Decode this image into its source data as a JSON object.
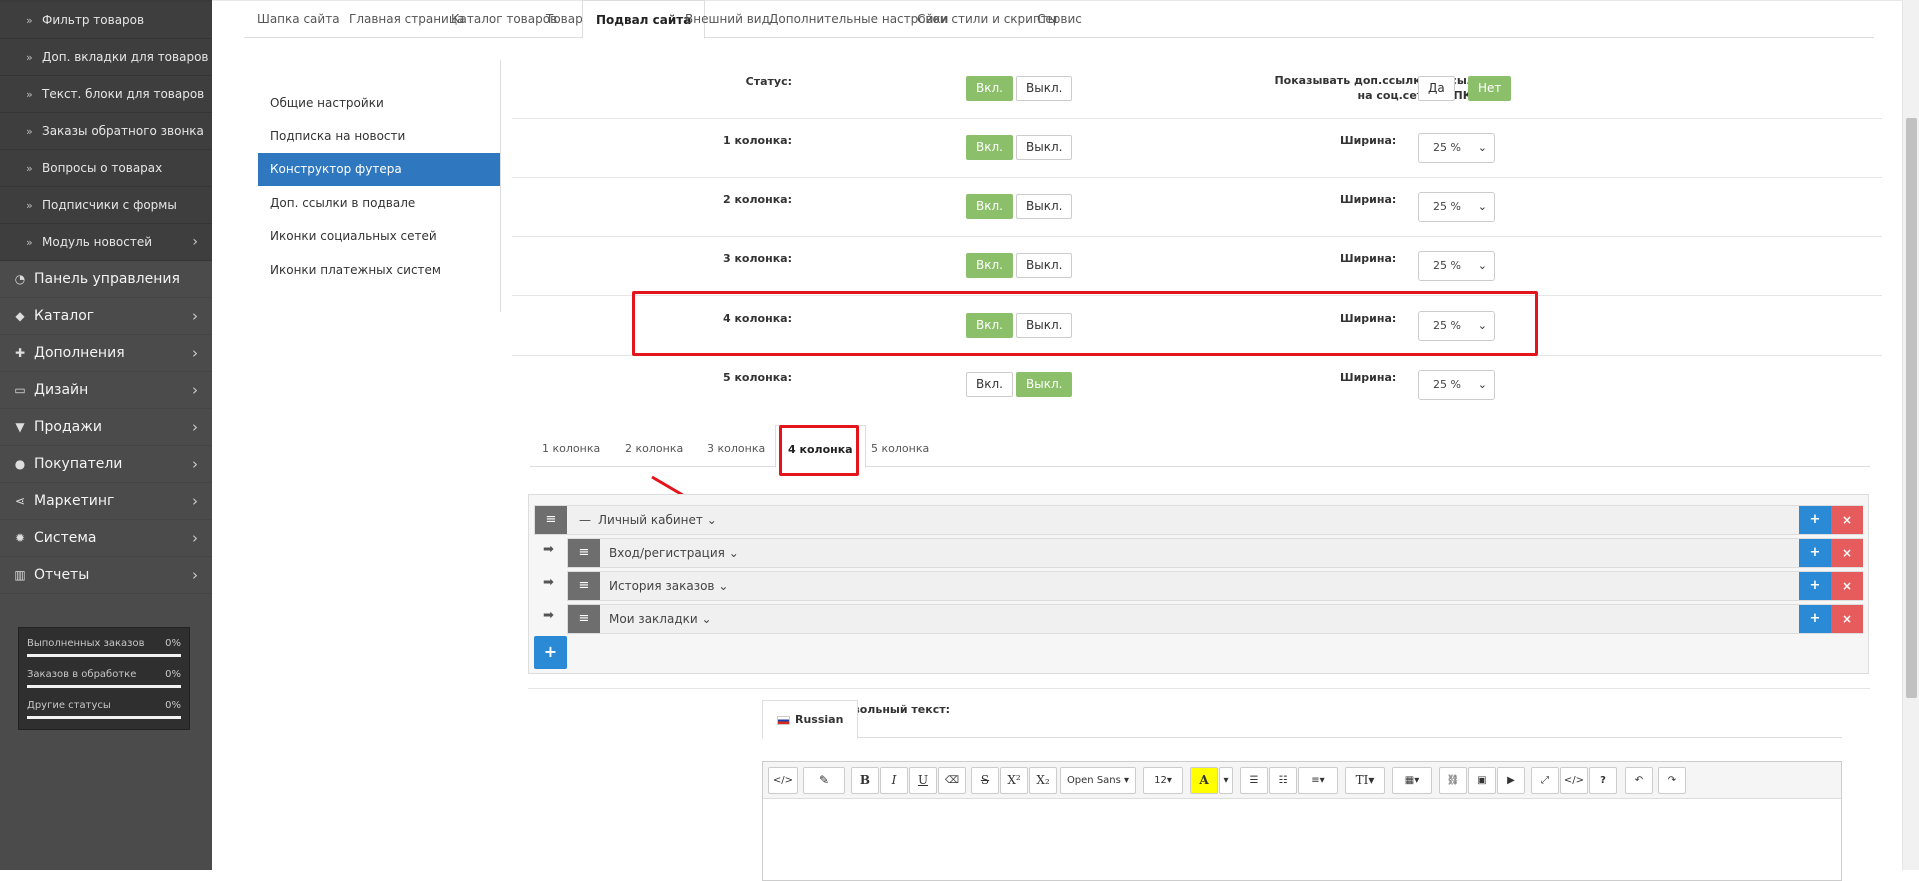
{
  "sidebar": {
    "sub_items": [
      {
        "label": "Фильтр товаров"
      },
      {
        "label": "Доп. вкладки для товаров"
      },
      {
        "label": "Текст. блоки для товаров"
      },
      {
        "label": "Заказы обратного звонка"
      },
      {
        "label": "Вопросы о товарах"
      },
      {
        "label": "Подписчики с формы"
      },
      {
        "label": "Модуль новостей"
      }
    ],
    "main_items": [
      {
        "label": "Панель управления",
        "icon": "dashboard-icon"
      },
      {
        "label": "Каталог",
        "icon": "tag-icon"
      },
      {
        "label": "Дополнения",
        "icon": "puzzle-icon"
      },
      {
        "label": "Дизайн",
        "icon": "monitor-icon"
      },
      {
        "label": "Продажи",
        "icon": "cart-icon"
      },
      {
        "label": "Покупатели",
        "icon": "user-icon"
      },
      {
        "label": "Маркетинг",
        "icon": "share-icon"
      },
      {
        "label": "Система",
        "icon": "gear-icon"
      },
      {
        "label": "Отчеты",
        "icon": "bar-chart-icon"
      }
    ],
    "stats": [
      {
        "label": "Выполненных заказов",
        "value": "0%"
      },
      {
        "label": "Заказов в обработке",
        "value": "0%"
      },
      {
        "label": "Другие статусы",
        "value": "0%"
      }
    ]
  },
  "top_tabs": [
    {
      "label": "Шапка сайта"
    },
    {
      "label": "Главная страница"
    },
    {
      "label": "Каталог товаров"
    },
    {
      "label": "Товар"
    },
    {
      "label": "Подвал сайта",
      "active": true
    },
    {
      "label": "Внешний вид"
    },
    {
      "label": "Дополнительные настройки"
    },
    {
      "label": "Свои стили и скрипты"
    },
    {
      "label": "Сервис"
    }
  ],
  "sub_menu": [
    {
      "label": "Общие настройки"
    },
    {
      "label": "Подписка на новости"
    },
    {
      "label": "Конструктор футера",
      "active": true
    },
    {
      "label": "Доп. ссылки в подвале"
    },
    {
      "label": "Иконки социальных сетей"
    },
    {
      "label": "Иконки платежных систем"
    }
  ],
  "form": {
    "on_label": "Вкл.",
    "off_label": "Выкл.",
    "yes_label": "Да",
    "no_label": "Нет",
    "width_label": "Ширина:",
    "status_label": "Статус:",
    "status_right_label_line1": "Показывать доп.ссылки и ссылки",
    "status_right_label_line2": "на соц.сети на ПК:",
    "help_glyph": "?",
    "rows": [
      {
        "label": "1 колонка:",
        "state": "on",
        "width": "25 %"
      },
      {
        "label": "2 колонка:",
        "state": "on",
        "width": "25 %"
      },
      {
        "label": "3 колонка:",
        "state": "on",
        "width": "25 %"
      },
      {
        "label": "4 колонка:",
        "state": "on",
        "width": "25 %"
      },
      {
        "label": "5 колонка:",
        "state": "off",
        "width": "25 %"
      }
    ]
  },
  "column_tabs": [
    {
      "label": "1 колонка"
    },
    {
      "label": "2 колонка"
    },
    {
      "label": "3 колонка"
    },
    {
      "label": "4 колонка",
      "active": true
    },
    {
      "label": "5 колонка"
    }
  ],
  "builder": {
    "parent": {
      "label": "Личный кабинет"
    },
    "children": [
      {
        "label": "Вход/регистрация"
      },
      {
        "label": "История заказов"
      },
      {
        "label": "Мои закладки"
      }
    ],
    "plus_glyph": "+",
    "close_glyph": "×"
  },
  "custom_text": {
    "label": "Произвольный текст:",
    "language_tab": "Russian"
  },
  "editor_toolbar": {
    "code": "</>",
    "magic": "✎",
    "bold": "B",
    "italic": "I",
    "underline": "U",
    "eraser": "⌫",
    "strike": "S",
    "superscript": "X²",
    "subscript": "X₂",
    "font_name": "Open Sans ▾",
    "font_size": "12▾",
    "color": "A",
    "color_caret": "▾",
    "ul": "☰",
    "ol": "☷",
    "align": "≡▾",
    "text_height": "TI▾",
    "table": "▦▾",
    "link": "⛓",
    "picture": "▣",
    "video": "▶",
    "fullscreen": "⤢",
    "codeview": "</>",
    "help": "?",
    "undo": "↶",
    "redo": "↷"
  },
  "colors": {
    "sidebar_bg": "#4b4b4b",
    "accent_blue": "#2f78c0",
    "toggle_green": "#8cbf6a",
    "highlight_red": "#e4141b",
    "danger": "#e65b5b",
    "primary": "#2b8ad6"
  }
}
